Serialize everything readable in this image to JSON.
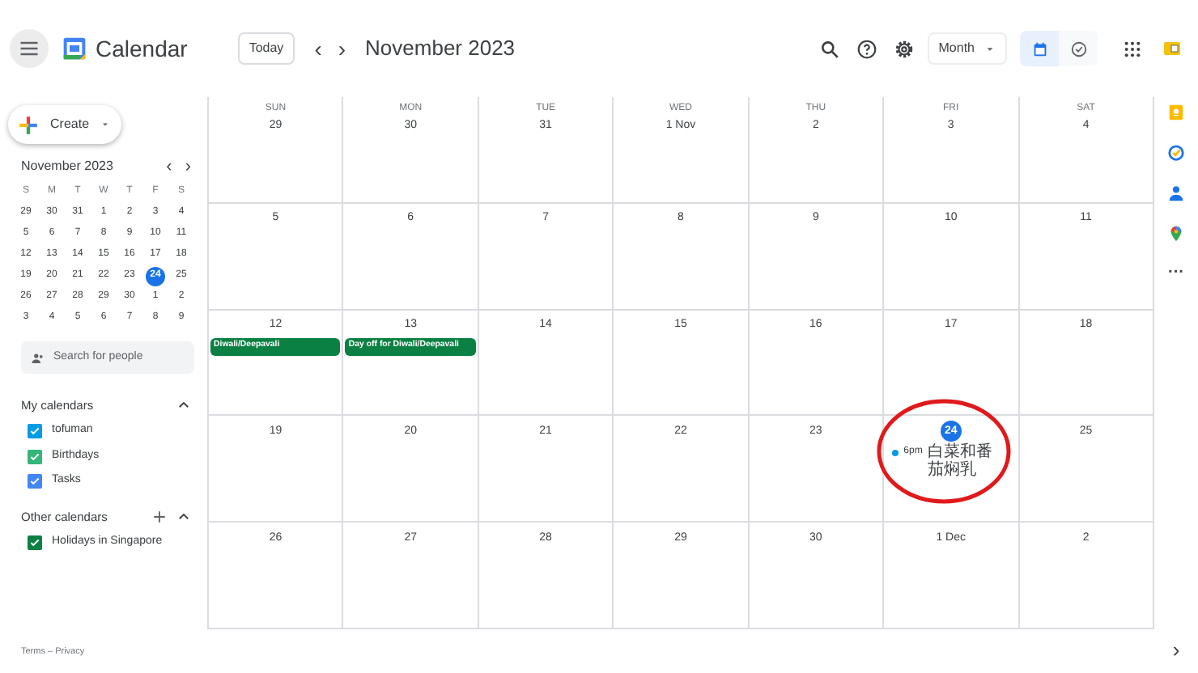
{
  "header": {
    "app_name": "Calendar",
    "today_button": "Today",
    "prev": "‹",
    "next": "›",
    "period": "November 2023",
    "view_select": "Month",
    "view_toggle": [
      {
        "kind": "calendar",
        "selected": true
      },
      {
        "kind": "tasks",
        "selected": false
      }
    ]
  },
  "sidebar": {
    "create": "Create",
    "mini_calendar": {
      "title": "November 2023",
      "weekdays": [
        "S",
        "M",
        "T",
        "W",
        "T",
        "F",
        "S"
      ],
      "weeks": [
        [
          {
            "label": "29",
            "selected": false
          },
          {
            "label": "30",
            "selected": false
          },
          {
            "label": "31",
            "selected": false
          },
          {
            "label": "1",
            "selected": false
          },
          {
            "label": "2",
            "selected": false
          },
          {
            "label": "3",
            "selected": false
          },
          {
            "label": "4",
            "selected": false
          }
        ],
        [
          {
            "label": "5",
            "selected": false
          },
          {
            "label": "6",
            "selected": false
          },
          {
            "label": "7",
            "selected": false
          },
          {
            "label": "8",
            "selected": false
          },
          {
            "label": "9",
            "selected": false
          },
          {
            "label": "10",
            "selected": false
          },
          {
            "label": "11",
            "selected": false
          }
        ],
        [
          {
            "label": "12",
            "selected": false
          },
          {
            "label": "13",
            "selected": false
          },
          {
            "label": "14",
            "selected": false
          },
          {
            "label": "15",
            "selected": false
          },
          {
            "label": "16",
            "selected": false
          },
          {
            "label": "17",
            "selected": false
          },
          {
            "label": "18",
            "selected": false
          }
        ],
        [
          {
            "label": "19",
            "selected": false
          },
          {
            "label": "20",
            "selected": false
          },
          {
            "label": "21",
            "selected": false
          },
          {
            "label": "22",
            "selected": false
          },
          {
            "label": "23",
            "selected": false
          },
          {
            "label": "24",
            "selected": true
          },
          {
            "label": "25",
            "selected": false
          }
        ],
        [
          {
            "label": "26",
            "selected": false
          },
          {
            "label": "27",
            "selected": false
          },
          {
            "label": "28",
            "selected": false
          },
          {
            "label": "29",
            "selected": false
          },
          {
            "label": "30",
            "selected": false
          },
          {
            "label": "1",
            "selected": false
          },
          {
            "label": "2",
            "selected": false
          }
        ],
        [
          {
            "label": "3",
            "selected": false
          },
          {
            "label": "4",
            "selected": false
          },
          {
            "label": "5",
            "selected": false
          },
          {
            "label": "6",
            "selected": false
          },
          {
            "label": "7",
            "selected": false
          },
          {
            "label": "8",
            "selected": false
          },
          {
            "label": "9",
            "selected": false
          }
        ]
      ]
    },
    "search": {
      "placeholder": "Search for people"
    },
    "my_calendars": {
      "title": "My calendars",
      "items": [
        {
          "label": "tofuman",
          "checked": true,
          "color": "#039be5"
        },
        {
          "label": "Birthdays",
          "checked": true,
          "color": "#33b679"
        },
        {
          "label": "Tasks",
          "checked": true,
          "color": "#4285f4"
        }
      ]
    },
    "other_calendars": {
      "title": "Other calendars",
      "items": [
        {
          "label": "Holidays in Singapore",
          "checked": true,
          "color": "#0b8043"
        }
      ]
    },
    "footer": "Terms – Privacy"
  },
  "month": {
    "weekdays": [
      "SUN",
      "MON",
      "TUE",
      "WED",
      "THU",
      "FRI",
      "SAT"
    ],
    "weeks": [
      [
        {
          "date": "29",
          "today": false
        },
        {
          "date": "30",
          "today": false
        },
        {
          "date": "31",
          "today": false
        },
        {
          "date": "1 Nov",
          "today": false
        },
        {
          "date": "2",
          "today": false
        },
        {
          "date": "3",
          "today": false
        },
        {
          "date": "4",
          "today": false
        }
      ],
      [
        {
          "date": "5",
          "today": false
        },
        {
          "date": "6",
          "today": false
        },
        {
          "date": "7",
          "today": false
        },
        {
          "date": "8",
          "today": false
        },
        {
          "date": "9",
          "today": false
        },
        {
          "date": "10",
          "today": false
        },
        {
          "date": "11",
          "today": false
        }
      ],
      [
        {
          "date": "12",
          "today": false,
          "events": [
            {
              "kind": "allday",
              "title": "Diwali/Deepavali",
              "color": "#0b8043"
            }
          ]
        },
        {
          "date": "13",
          "today": false,
          "events": [
            {
              "kind": "allday",
              "title": "Day off for Diwali/Deepavali",
              "color": "#0b8043"
            }
          ]
        },
        {
          "date": "14",
          "today": false
        },
        {
          "date": "15",
          "today": false
        },
        {
          "date": "16",
          "today": false
        },
        {
          "date": "17",
          "today": false
        },
        {
          "date": "18",
          "today": false
        }
      ],
      [
        {
          "date": "19",
          "today": false
        },
        {
          "date": "20",
          "today": false
        },
        {
          "date": "21",
          "today": false
        },
        {
          "date": "22",
          "today": false
        },
        {
          "date": "23",
          "today": false
        },
        {
          "date": "24",
          "today": true,
          "events": [
            {
              "kind": "timed",
              "time": "6pm",
              "title": "白菜和番茄焖乳",
              "color": "#039be5"
            }
          ]
        },
        {
          "date": "25",
          "today": false
        }
      ],
      [
        {
          "date": "26",
          "today": false
        },
        {
          "date": "27",
          "today": false
        },
        {
          "date": "28",
          "today": false
        },
        {
          "date": "29",
          "today": false
        },
        {
          "date": "30",
          "today": false
        },
        {
          "date": "1 Dec",
          "today": false
        },
        {
          "date": "2",
          "today": false
        }
      ]
    ]
  },
  "side_panel": {
    "more": "···",
    "expand": "›"
  }
}
